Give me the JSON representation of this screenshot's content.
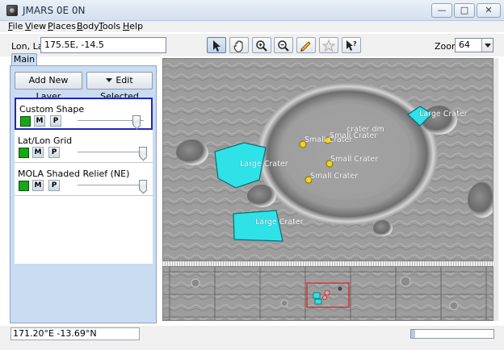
{
  "window": {
    "title": "JMARS 0E 0N",
    "minimize": "—",
    "maximize": "□",
    "close": "✕"
  },
  "menu": [
    "File",
    "View",
    "Places",
    "Body",
    "Tools",
    "Help"
  ],
  "toolbar": {
    "lonlat_label": "Lon, Lat",
    "lonlat_value": "175.5E, -14.5",
    "tools": [
      "select-arrow-icon",
      "pan-hand-icon",
      "zoom-in-icon",
      "zoom-out-icon",
      "measure-ruler-icon",
      "star-icon",
      "help-pointer-icon"
    ],
    "zoom_label": "Zoom:",
    "zoom_value": "64"
  },
  "left_panel": {
    "tab": "Main",
    "add_layer": "Add New Layer",
    "edit_selected": "Edit Selected",
    "layers": [
      {
        "name": "Custom Shape",
        "selected": true,
        "opacity": 0.9,
        "m": "M",
        "p": "P",
        "color": "#16a816"
      },
      {
        "name": "Lat/Lon Grid",
        "selected": false,
        "opacity": 1.0,
        "m": "M",
        "p": "P",
        "color": "#16a816"
      },
      {
        "name": "MOLA Shaded Relief (NE)",
        "selected": false,
        "opacity": 1.0,
        "m": "M",
        "p": "P",
        "color": "#16a816"
      }
    ]
  },
  "map": {
    "shape_fill": "#2ee2e8",
    "labels": {
      "large_crater": "Large Crater",
      "small_crater": "Small Crater",
      "crater_dm": "crater dm"
    }
  },
  "status": {
    "coords": "171.20°E -13.69°N",
    "progress": 0.05
  }
}
